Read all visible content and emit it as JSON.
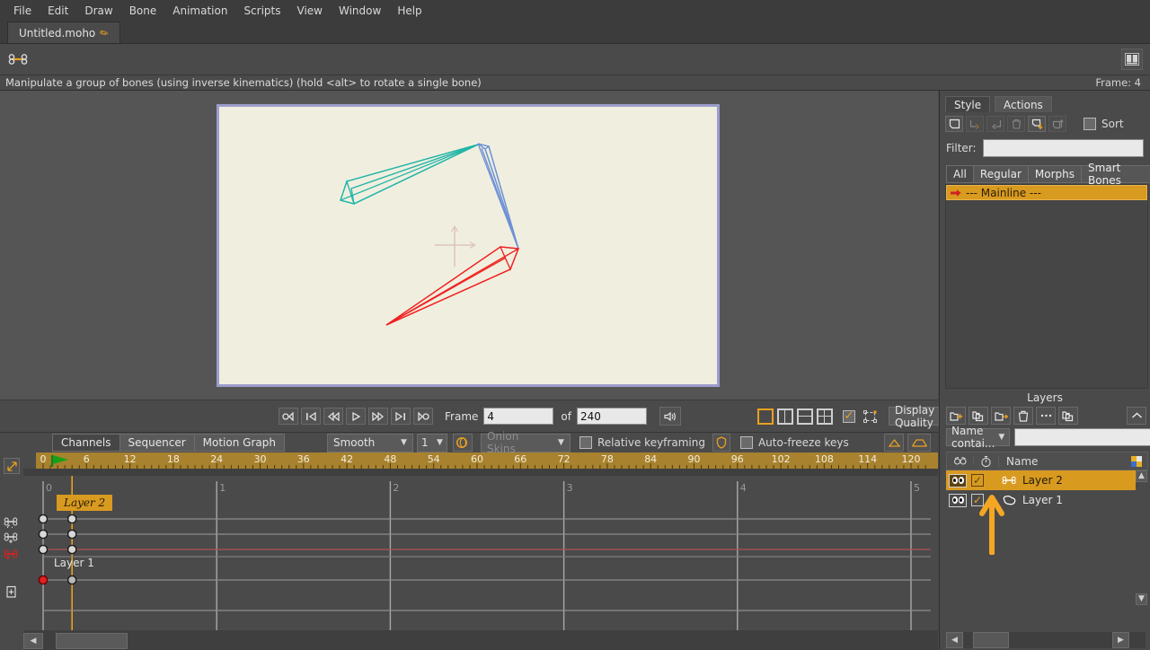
{
  "menu": {
    "items": [
      "File",
      "Edit",
      "Draw",
      "Bone",
      "Animation",
      "Scripts",
      "View",
      "Window",
      "Help"
    ]
  },
  "document_tab": {
    "title": "Untitled.moho",
    "modified_icon": "pencil-icon"
  },
  "toolbar": {
    "tool_icon": "bone-manipulate-icon",
    "panels_toggle_icon": "panels-layout-icon"
  },
  "hint_bar": {
    "text": "Manipulate a group of bones (using inverse kinematics) (hold <alt> to rotate a single bone)",
    "frame_label": "Frame: 4"
  },
  "canvas": {
    "paper_color": "#f0efdf",
    "border_color": "#9d9dcd",
    "origin_marker": "origin-crosshair-icon",
    "bones": [
      {
        "name": "bone-upper-teal",
        "color": "#2ec4b6"
      },
      {
        "name": "bone-mid-blue",
        "color": "#6a8fd8"
      },
      {
        "name": "bone-lower-red",
        "color": "#f02020"
      }
    ]
  },
  "playback": {
    "buttons": [
      {
        "name": "jump-to-start-button",
        "glyph": "◁∣",
        "label": "o◁"
      },
      {
        "name": "previous-keyframe-button",
        "label": "|◁"
      },
      {
        "name": "step-back-button",
        "label": "◁◁"
      },
      {
        "name": "play-button",
        "label": "▷"
      },
      {
        "name": "step-forward-button",
        "label": "▷▷"
      },
      {
        "name": "next-keyframe-button",
        "label": "▷|"
      },
      {
        "name": "jump-to-end-button",
        "label": "▷o"
      }
    ],
    "frame_label": "Frame",
    "frame_value": "4",
    "of_label": "of",
    "total_frames_value": "240",
    "audio_icon": "speaker-icon",
    "view_modes": [
      "single-view",
      "two-pane-view",
      "three-pane-view",
      "four-pane-view"
    ],
    "selected_view_mode": 0,
    "extra_checkbox_checked": true,
    "bounds_icon": "selection-bounds-icon",
    "display_quality_label": "Display Quality"
  },
  "timeline_toolbar": {
    "tabs": [
      {
        "label": "Channels",
        "active": true
      },
      {
        "label": "Sequencer",
        "active": false
      },
      {
        "label": "Motion Graph",
        "active": false
      }
    ],
    "interpolation": "Smooth",
    "interpolation_value": "1",
    "cycle_icon": "cycle-icon",
    "onion_skins_label": "Onion Skins",
    "relative_keyframing_label": "Relative keyframing",
    "relative_keyframing_checked": false,
    "shield_icon": "shield-icon",
    "auto_freeze_label": "Auto-freeze keys",
    "auto_freeze_checked": false,
    "peak_buttons": [
      "ease-in-icon",
      "ease-both-icon"
    ]
  },
  "timeline": {
    "ruler_color": "#a8822e",
    "ruler_ticks": [
      0,
      6,
      12,
      18,
      24,
      30,
      36,
      42,
      48,
      54,
      60,
      66,
      72,
      78,
      84,
      90,
      96,
      102,
      108,
      114,
      120
    ],
    "playhead_frame": 4,
    "start_marker_icon": "green-flag-icon",
    "second_labels": [
      "0",
      "1",
      "2",
      "3",
      "4",
      "5"
    ],
    "channel_icons": [
      {
        "name": "bone-rotate-channel-icon",
        "enabled": true
      },
      {
        "name": "bone-translate-channel-icon",
        "enabled": true
      },
      {
        "name": "bone-selected-channel-icon",
        "enabled": true,
        "color": "#e02020"
      },
      {
        "name": "layer-transform-channel-icon",
        "enabled": true
      }
    ],
    "groups": [
      {
        "label": "Layer 2",
        "selected": true,
        "rows": [
          {
            "name": "bone-rotation-row",
            "keys": [
              0,
              4
            ],
            "highlight": false
          },
          {
            "name": "bone-translation-row",
            "keys": [
              0,
              4
            ],
            "highlight": false
          },
          {
            "name": "bone-selected-row",
            "keys": [
              0,
              4
            ],
            "highlight": true
          }
        ]
      },
      {
        "label": "Layer 1",
        "selected": false,
        "rows": [
          {
            "name": "layer-transform-row",
            "keys": [
              0,
              4
            ],
            "highlight": false,
            "first_key_red": true
          }
        ]
      }
    ]
  },
  "style_panel": {
    "tabs": [
      {
        "label": "Style",
        "active": false
      },
      {
        "label": "Actions",
        "active": true
      }
    ],
    "toolbar_icons": [
      {
        "name": "new-action-icon",
        "enabled": true
      },
      {
        "name": "copy-action-right-icon",
        "enabled": false
      },
      {
        "name": "copy-action-left-icon",
        "enabled": false
      },
      {
        "name": "delete-action-icon",
        "enabled": false
      },
      {
        "name": "insert-action-down-icon",
        "enabled": true
      },
      {
        "name": "insert-action-up-icon",
        "enabled": false
      }
    ],
    "sort_label": "Sort",
    "sort_checked": false,
    "filter_label": "Filter:",
    "filter_value": "",
    "category_tabs": [
      {
        "label": "All",
        "active": true
      },
      {
        "label": "Regular",
        "active": false
      },
      {
        "label": "Morphs",
        "active": false
      },
      {
        "label": "Smart Bones",
        "active": false
      }
    ],
    "action_rows": [
      {
        "label": "--- Mainline ---",
        "selected": true,
        "icon": "red-arrow-icon"
      }
    ]
  },
  "layers_panel": {
    "title": "Layers",
    "toolbar_icons": [
      {
        "name": "new-layer-icon"
      },
      {
        "name": "duplicate-layer-icon"
      },
      {
        "name": "export-layer-icon"
      },
      {
        "name": "delete-layer-icon"
      },
      {
        "name": "more-options-icon"
      },
      {
        "name": "group-layers-icon"
      },
      {
        "name": "collapse-panel-icon"
      }
    ],
    "search_mode": "Name contai...",
    "search_value": "",
    "columns": [
      {
        "name": "visibility-column",
        "icon": "eye-icon"
      },
      {
        "name": "render-column",
        "icon": "stopwatch-icon"
      },
      {
        "name": "name-column",
        "label": "Name"
      },
      {
        "name": "color-column",
        "icon": "color-swatch-icon"
      }
    ],
    "rows": [
      {
        "name": "Layer 2",
        "type_icon": "bone-layer-icon",
        "selected": true,
        "visible": true,
        "render": true
      },
      {
        "name": "Layer 1",
        "type_icon": "vector-layer-icon",
        "selected": false,
        "visible": true,
        "render": true
      }
    ],
    "annotation_arrow": {
      "name": "highlight-arrow",
      "color": "#f5a623",
      "direction": "up"
    }
  }
}
